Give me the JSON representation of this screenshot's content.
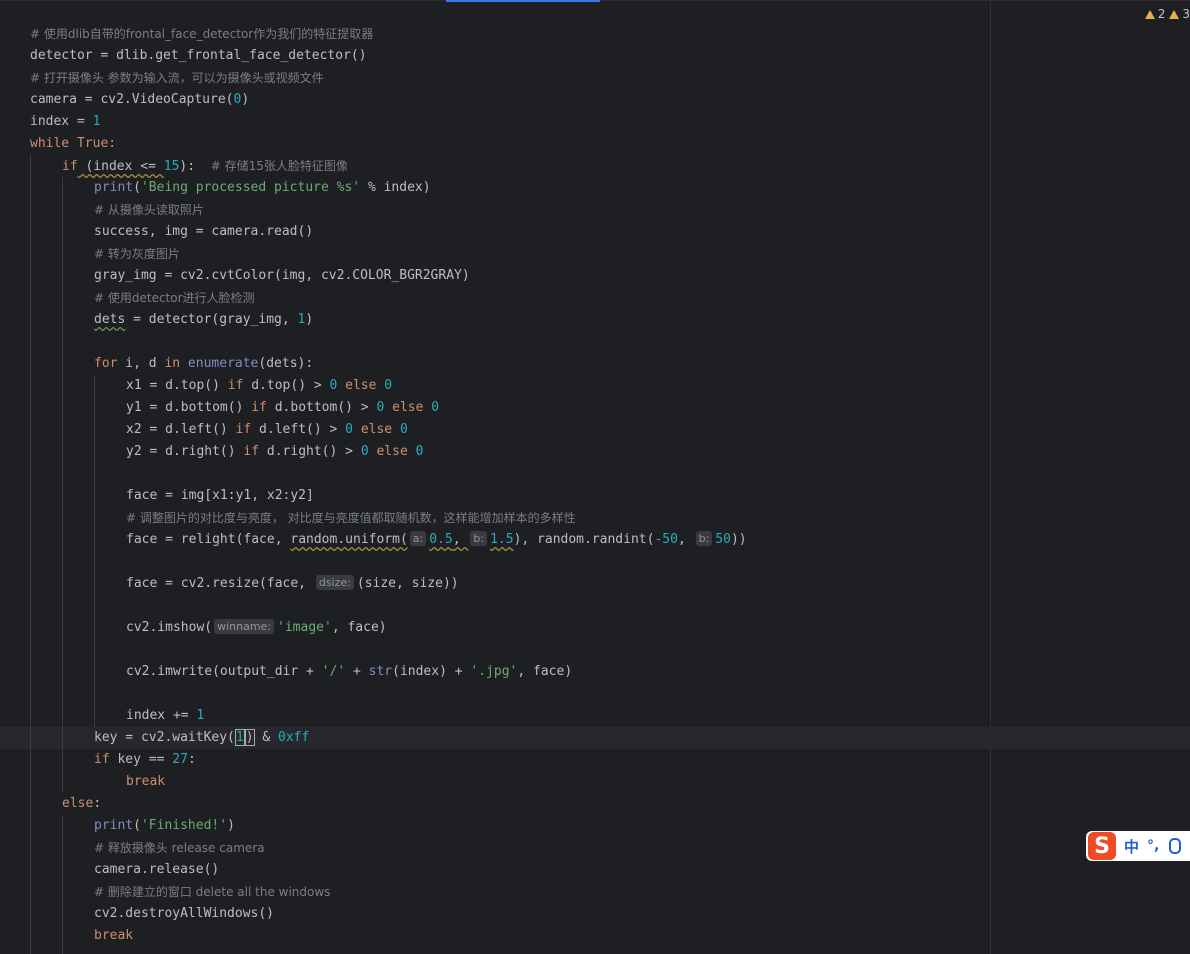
{
  "status": {
    "warnings": [
      {
        "count": "2",
        "color": "#e0b34a"
      },
      {
        "count": "3",
        "color": "#e0b34a"
      }
    ]
  },
  "ime": {
    "logo": "S",
    "lang": "中",
    "punct": "°,"
  },
  "code": {
    "l1": "# 使用dlib自带的frontal_face_detector作为我们的特征提取器",
    "l2a": "detector = dlib.get_frontal_face_detector()",
    "l3": "# 打开摄像头 参数为输入流，可以为摄像头或视频文件",
    "l4a": "camera = cv2.VideoCapture(",
    "l4n": "0",
    "l4b": ")",
    "l5a": "index = ",
    "l5n": "1",
    "l6k": "while",
    "l6b": " True:",
    "l7k": "if",
    "l7b": " (index <= ",
    "l7n": "15",
    "l7c": "):  ",
    "l7m": "# 存储15张人脸特征图像",
    "l8f": "print",
    "l8a": "(",
    "l8s": "'Being processed picture %s'",
    "l8b": " % index)",
    "l9": "# 从摄像头读取照片",
    "l10": "success, img = camera.read()",
    "l11": "# 转为灰度图片",
    "l12": "gray_img = cv2.cvtColor(img, cv2.COLOR_BGR2GRAY)",
    "l13": "# 使用detector进行人脸检测",
    "l14v": "dets",
    "l14a": " = detector(gray_img, ",
    "l14n": "1",
    "l14b": ")",
    "l15k": "for",
    "l15a": " i, d ",
    "l15k2": "in",
    "l15f": " enumerate",
    "l15b": "(dets):",
    "l16a": "x1 = d.top() ",
    "l16b": " d.top() > ",
    "l17a": "y1 = d.bottom() ",
    "l17b": " d.bottom() > ",
    "l18a": "x2 = d.left() ",
    "l18b": " d.left() > ",
    "l19a": "y2 = d.right() ",
    "l19b": " d.right() > ",
    "kw_if": "if",
    "kw_else": "else",
    "zero": "0",
    "l20": "face = img[x1:y1, x2:y2]",
    "l21": "# 调整图片的对比度与亮度， 对比度与亮度值都取随机数，这样能增加样本的多样性",
    "l22a": "face = relight(face, ",
    "l22w": "random.uniform(",
    "l22h1": "a:",
    "l22n1": "0.5",
    "l22c": ", ",
    "l22h2": "b:",
    "l22n2": "1.5",
    "l22b": "), random.randint(",
    "l22n3": "-50",
    "l22d": ", ",
    "l22h3": "b:",
    "l22n4": "50",
    "l22e": "))",
    "l23a": "face = cv2.resize(face, ",
    "l23h": "dsize:",
    "l23b": "(size, size))",
    "l24a": "cv2.imshow(",
    "l24h": "winname:",
    "l24s": "'image'",
    "l24b": ", face)",
    "l25a": "cv2.imwrite(output_dir + ",
    "l25s1": "'/'",
    "l25b": " + ",
    "l25f": "str",
    "l25c": "(index) + ",
    "l25s2": "'.jpg'",
    "l25d": ", face)",
    "l26a": "index += ",
    "l26n": "1",
    "l27a": "key = cv2.waitKey(",
    "l27n": "1",
    "l27b": ")",
    "l27c": " & ",
    "l27h": "0xff",
    "l28k": "if",
    "l28a": " key == ",
    "l28n": "27",
    "l28b": ":",
    "l29k": "break",
    "l30k": "else",
    "l30b": ":",
    "l31f": "print",
    "l31a": "(",
    "l31s": "'Finished!'",
    "l31b": ")",
    "l32": "# 释放摄像头 release camera",
    "l33": "camera.release()",
    "l34": "# 删除建立的窗口 delete all the windows",
    "l35": "cv2.destroyAllWindows()",
    "l36k": "break"
  }
}
